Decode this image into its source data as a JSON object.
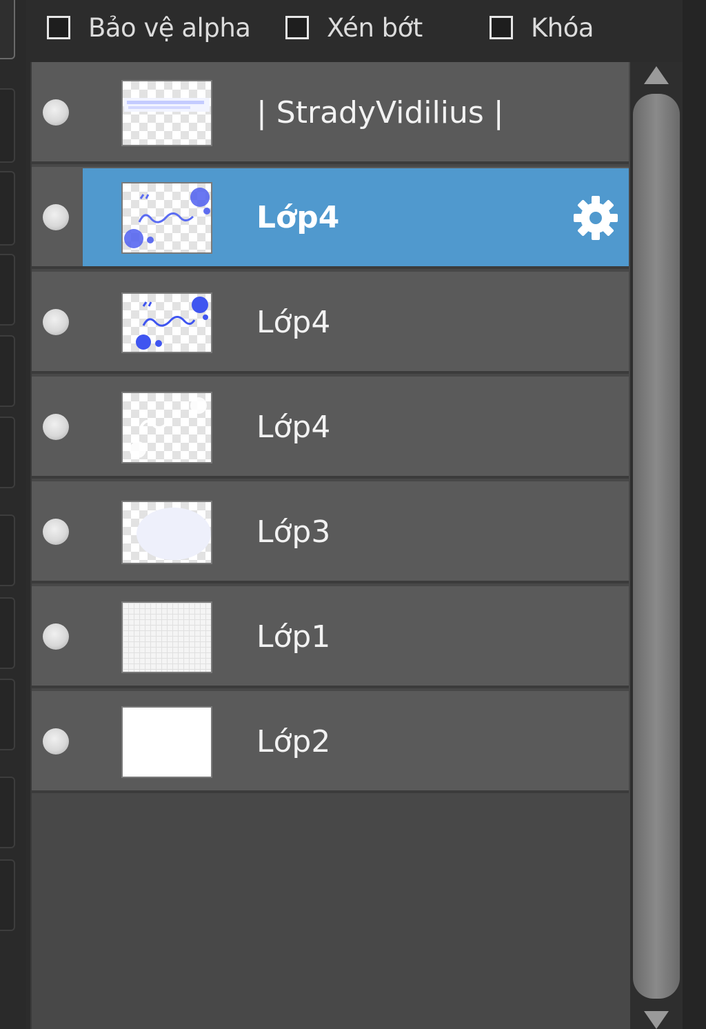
{
  "options": {
    "alpha_protect_label": "Bảo vệ alpha",
    "clip_label": "Xén bớt",
    "lock_label": "Khóa",
    "alpha_protect_checked": false,
    "clip_checked": false,
    "lock_checked": false
  },
  "layers": [
    {
      "name": "| StradyVidilius |",
      "selected": false,
      "thumb": "text-banner"
    },
    {
      "name": "Lớp4",
      "selected": true,
      "thumb": "blue-doodle"
    },
    {
      "name": "Lớp4",
      "selected": false,
      "thumb": "blue-doodle"
    },
    {
      "name": "Lớp4",
      "selected": false,
      "thumb": "faint-white"
    },
    {
      "name": "Lớp3",
      "selected": false,
      "thumb": "pale-blob"
    },
    {
      "name": "Lớp1",
      "selected": false,
      "thumb": "grid"
    },
    {
      "name": "Lớp2",
      "selected": false,
      "thumb": "white"
    }
  ],
  "colors": {
    "selected_row": "#5099ce",
    "row": "#5a5a5a",
    "doodle_blue": "#3f55f0"
  },
  "icons": {
    "visibility": "visibility-dot-icon",
    "layer_settings": "gear-icon",
    "scroll_up": "arrow-up-icon",
    "scroll_down": "arrow-down-icon"
  }
}
